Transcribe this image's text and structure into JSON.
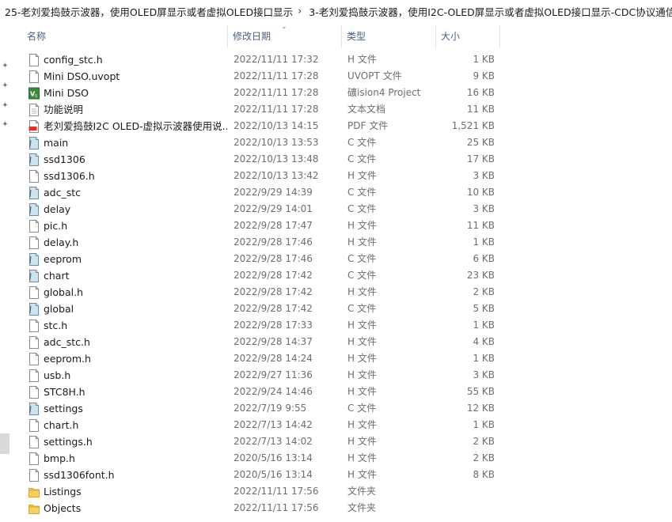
{
  "breadcrumb": [
    "25-老刘爱捣鼓示波器，使用OLED屏显示或者虚拟OLED接口显示",
    "3-老刘爱捣鼓示波器，使用I2C-OLED屏显示或者虚拟OLED接口显示-CDC协议通信"
  ],
  "columns": {
    "name": "名称",
    "date": "修改日期",
    "type": "类型",
    "size": "大小"
  },
  "files": [
    {
      "name": "config_stc.h",
      "date": "2022/11/11 17:32",
      "type": "H 文件",
      "size": "1 KB",
      "icon": "h-file-icon"
    },
    {
      "name": "Mini DSO.uvopt",
      "date": "2022/11/11 17:28",
      "type": "UVOPT 文件",
      "size": "9 KB",
      "icon": "generic-file-icon"
    },
    {
      "name": "Mini DSO",
      "date": "2022/11/11 17:28",
      "type": "礦ision4 Project",
      "size": "16 KB",
      "icon": "keil-project-icon"
    },
    {
      "name": "功能说明",
      "date": "2022/11/11 17:28",
      "type": "文本文档",
      "size": "11 KB",
      "icon": "text-file-icon"
    },
    {
      "name": "老刘爱捣鼓I2C OLED-虚拟示波器使用说...",
      "date": "2022/10/13 14:15",
      "type": "PDF 文件",
      "size": "1,521 KB",
      "icon": "pdf-file-icon"
    },
    {
      "name": "main",
      "date": "2022/10/13 13:53",
      "type": "C 文件",
      "size": "25 KB",
      "icon": "c-file-icon"
    },
    {
      "name": "ssd1306",
      "date": "2022/10/13 13:48",
      "type": "C 文件",
      "size": "17 KB",
      "icon": "c-file-icon"
    },
    {
      "name": "ssd1306.h",
      "date": "2022/10/13 13:42",
      "type": "H 文件",
      "size": "3 KB",
      "icon": "h-file-icon"
    },
    {
      "name": "adc_stc",
      "date": "2022/9/29 14:39",
      "type": "C 文件",
      "size": "10 KB",
      "icon": "c-file-icon"
    },
    {
      "name": "delay",
      "date": "2022/9/29 14:01",
      "type": "C 文件",
      "size": "3 KB",
      "icon": "c-file-icon"
    },
    {
      "name": "pic.h",
      "date": "2022/9/28 17:47",
      "type": "H 文件",
      "size": "11 KB",
      "icon": "h-file-icon"
    },
    {
      "name": "delay.h",
      "date": "2022/9/28 17:46",
      "type": "H 文件",
      "size": "1 KB",
      "icon": "h-file-icon"
    },
    {
      "name": "eeprom",
      "date": "2022/9/28 17:46",
      "type": "C 文件",
      "size": "6 KB",
      "icon": "c-file-icon"
    },
    {
      "name": "chart",
      "date": "2022/9/28 17:42",
      "type": "C 文件",
      "size": "23 KB",
      "icon": "c-file-icon"
    },
    {
      "name": "global.h",
      "date": "2022/9/28 17:42",
      "type": "H 文件",
      "size": "2 KB",
      "icon": "h-file-icon"
    },
    {
      "name": "global",
      "date": "2022/9/28 17:42",
      "type": "C 文件",
      "size": "5 KB",
      "icon": "c-file-icon"
    },
    {
      "name": "stc.h",
      "date": "2022/9/28 17:33",
      "type": "H 文件",
      "size": "1 KB",
      "icon": "h-file-icon"
    },
    {
      "name": "adc_stc.h",
      "date": "2022/9/28 14:37",
      "type": "H 文件",
      "size": "4 KB",
      "icon": "h-file-icon"
    },
    {
      "name": "eeprom.h",
      "date": "2022/9/28 14:24",
      "type": "H 文件",
      "size": "1 KB",
      "icon": "h-file-icon"
    },
    {
      "name": "usb.h",
      "date": "2022/9/27 11:36",
      "type": "H 文件",
      "size": "3 KB",
      "icon": "h-file-icon"
    },
    {
      "name": "STC8H.h",
      "date": "2022/9/24 14:46",
      "type": "H 文件",
      "size": "55 KB",
      "icon": "h-file-icon"
    },
    {
      "name": "settings",
      "date": "2022/7/19 9:55",
      "type": "C 文件",
      "size": "12 KB",
      "icon": "c-file-icon"
    },
    {
      "name": "chart.h",
      "date": "2022/7/13 14:42",
      "type": "H 文件",
      "size": "1 KB",
      "icon": "h-file-icon"
    },
    {
      "name": "settings.h",
      "date": "2022/7/13 14:02",
      "type": "H 文件",
      "size": "2 KB",
      "icon": "h-file-icon"
    },
    {
      "name": "bmp.h",
      "date": "2020/5/16 13:14",
      "type": "H 文件",
      "size": "2 KB",
      "icon": "h-file-icon"
    },
    {
      "name": "ssd1306font.h",
      "date": "2020/5/16 13:14",
      "type": "H 文件",
      "size": "8 KB",
      "icon": "h-file-icon"
    },
    {
      "name": "Listings",
      "date": "2022/11/11 17:56",
      "type": "文件夹",
      "size": "",
      "icon": "folder-icon"
    },
    {
      "name": "Objects",
      "date": "2022/11/11 17:56",
      "type": "文件夹",
      "size": "",
      "icon": "folder-icon"
    }
  ]
}
